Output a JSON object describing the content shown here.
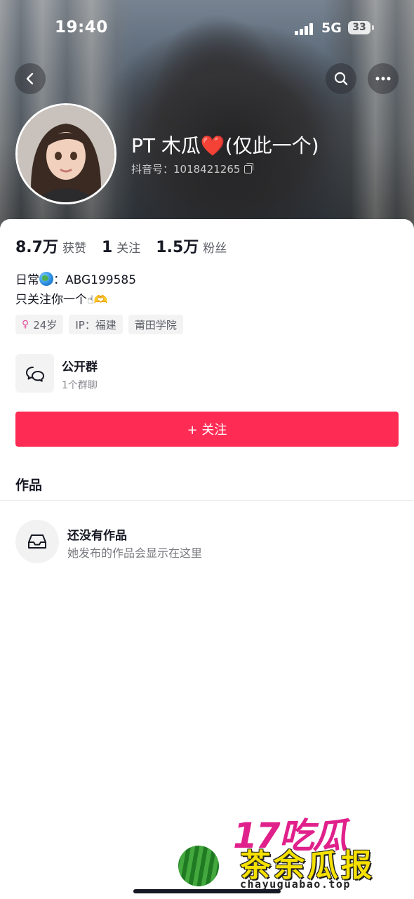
{
  "status_bar": {
    "time": "19:40",
    "network": "5G",
    "battery": "33"
  },
  "profile": {
    "name": "PT 木瓜❤️(仅此一个)",
    "douyin_id": "抖音号：1018421265"
  },
  "stats": {
    "likes_num": "8.7万",
    "likes_label": "获赞",
    "following_num": "1",
    "following_label": "关注",
    "followers_num": "1.5万",
    "followers_label": "粉丝"
  },
  "bio": {
    "line1_prefix": "日常",
    "line1_suffix": "：ABG199585",
    "line2_text": "只关注你一个",
    "line2_emoji": "☝🫶"
  },
  "tags": {
    "age": "24岁",
    "ip": "IP：福建",
    "school": "莆田学院"
  },
  "group": {
    "title": "公开群",
    "subtitle": "1个群聊"
  },
  "follow_button": {
    "label": "+ 关注"
  },
  "works": {
    "title": "作品",
    "empty_title": "还没有作品",
    "empty_subtitle": "她发布的作品会显示在这里"
  },
  "watermark": {
    "top": "17吃瓜",
    "middle": "茶余瓜报",
    "url": "chayuguabao.top"
  },
  "colors": {
    "accent": "#fe2c55",
    "text_primary": "#161823",
    "text_secondary": "#5c5e66"
  }
}
